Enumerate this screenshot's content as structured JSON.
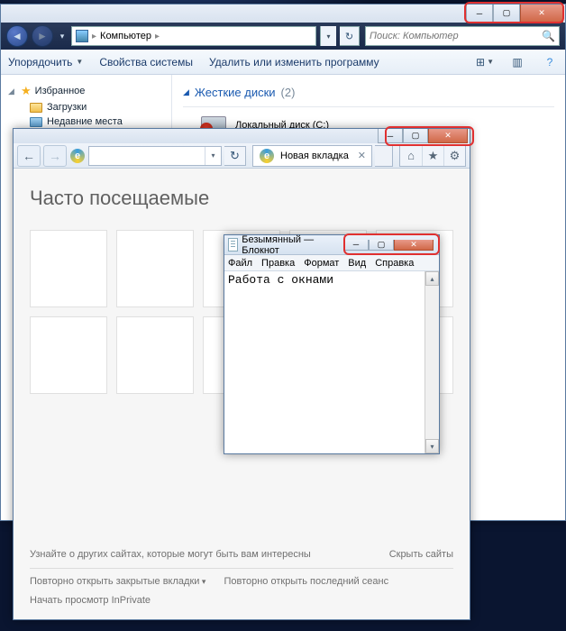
{
  "explorer": {
    "breadcrumb": "Компьютер",
    "search_placeholder": "Поиск: Компьютер",
    "toolbar": {
      "organize": "Упорядочить",
      "properties": "Свойства системы",
      "uninstall": "Удалить или изменить программу"
    },
    "sidebar": {
      "favorites": "Избранное",
      "downloads": "Загрузки",
      "recent": "Недавние места"
    },
    "section": {
      "title": "Жесткие диски",
      "count": "(2)",
      "disk1": "Локальный диск (C:)"
    }
  },
  "ie": {
    "tab_label": "Новая вкладка",
    "page_title": "Часто посещаемые",
    "footer": {
      "discover": "Узнайте о других сайтах, которые могут быть вам интересны",
      "hide": "Скрыть сайты",
      "reopen_closed": "Повторно открыть закрытые вкладки",
      "reopen_last": "Повторно открыть последний сеанс",
      "inprivate": "Начать просмотр InPrivate"
    }
  },
  "notepad": {
    "title": "Безымянный — Блокнот",
    "menu": {
      "file": "Файл",
      "edit": "Правка",
      "format": "Формат",
      "view": "Вид",
      "help": "Справка"
    },
    "content": "Работа с окнами"
  }
}
